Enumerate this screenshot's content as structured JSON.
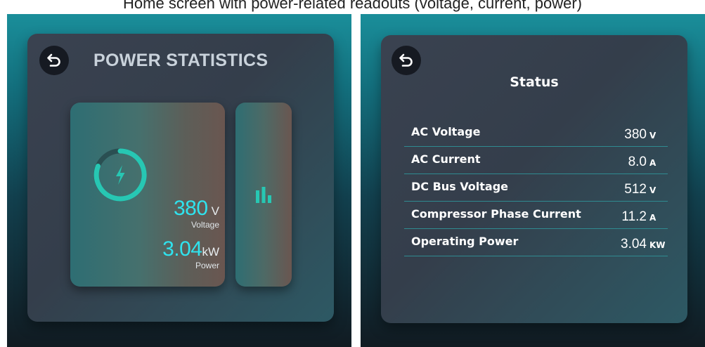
{
  "caption": "Home screen with power-related readouts (voltage, current, power)",
  "colors": {
    "accent": "#2fe3ee",
    "ring": "#27c7b3",
    "panel": "#363f4c",
    "screen_top": "#1a8e9a",
    "screen_bottom": "#111b22"
  },
  "left_screen": {
    "back_icon": "back-arrow-icon",
    "title": "POWER STATISTICS",
    "gauge_icon": "lightning-bolt-icon",
    "voltage": {
      "value": "380",
      "unit": "V",
      "label": "Voltage"
    },
    "power": {
      "value": "3.04",
      "unit": "kW",
      "label": "Power"
    },
    "side_card_icon": "bar-chart-icon"
  },
  "right_screen": {
    "back_icon": "back-arrow-icon",
    "title": "Status",
    "rows": [
      {
        "label": "AC Voltage",
        "value": "380",
        "unit": "V"
      },
      {
        "label": "AC Current",
        "value": "8.0",
        "unit": "A"
      },
      {
        "label": "DC Bus Voltage",
        "value": "512",
        "unit": "V"
      },
      {
        "label": "Compressor Phase Current",
        "value": "11.2",
        "unit": "A"
      },
      {
        "label": "Operating Power",
        "value": "3.04",
        "unit": "KW"
      }
    ]
  }
}
